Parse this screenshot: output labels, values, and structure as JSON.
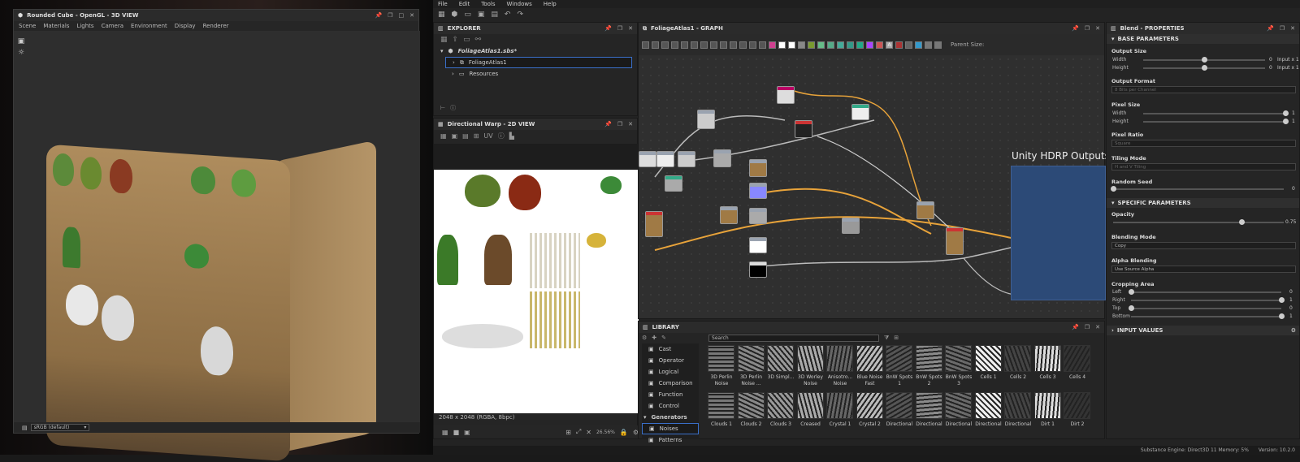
{
  "view3d": {
    "title": "Rounded Cube - OpenGL - 3D VIEW",
    "menu": [
      "Scene",
      "Materials",
      "Lights",
      "Camera",
      "Environment",
      "Display",
      "Renderer"
    ],
    "colorspace": "sRGB (default)"
  },
  "app_menu": [
    "File",
    "Edit",
    "Tools",
    "Windows",
    "Help"
  ],
  "explorer": {
    "title": "EXPLORER",
    "package": "FoliageAtlas1.sbs*",
    "graph_item": "FoliageAtlas1",
    "resources": "Resources"
  },
  "view2d": {
    "title": "Directional Warp - 2D VIEW",
    "uv_label": "UV",
    "info": "2048 x 2048 (RGBA, 8bpc)",
    "zoom": "26.56%"
  },
  "graph": {
    "title": "FoliageAtlas1 - GRAPH",
    "parent_size_label": "Parent Size:",
    "frame_label": "Unity HDRP Outputs"
  },
  "library": {
    "title": "LIBRARY",
    "search_placeholder": "Search",
    "categories": [
      "Cast",
      "Operator",
      "Logical",
      "Comparison",
      "Function",
      "Control"
    ],
    "group": "Generators",
    "subcategories": [
      "Noises",
      "Patterns"
    ],
    "row1": [
      "3D Perlin Noise",
      "3D Perlin Noise ...",
      "3D Simpl...",
      "3D Worley Noise",
      "Anisotro... Noise",
      "Blue Noise Fast",
      "BnW Spots 1",
      "BnW Spots 2",
      "BnW Spots 3",
      "Cells 1",
      "Cells 2",
      "Cells 3",
      "Cells 4"
    ],
    "row2": [
      "Clouds 1",
      "Clouds 2",
      "Clouds 3",
      "Creased",
      "Crystal 1",
      "Crystal 2",
      "Directional",
      "Directional",
      "Directional",
      "Directional",
      "Directional",
      "Dirt 1",
      "Dirt 2"
    ]
  },
  "properties": {
    "title": "Blend - PROPERTIES",
    "base_section": "BASE PARAMETERS",
    "output_size": {
      "label": "Output Size",
      "width_label": "Width",
      "height_label": "Height",
      "width_value": "0",
      "height_value": "0",
      "width_suffix": "Input x 1",
      "height_suffix": "Input x 1",
      "width_level": 0.5,
      "height_level": 0.5
    },
    "output_format": {
      "label": "Output Format",
      "value": "8 Bits per Channel"
    },
    "pixel_size": {
      "label": "Pixel Size",
      "width_label": "Width",
      "height_label": "Height",
      "width_value": "1",
      "height_value": "1",
      "width_level": 1,
      "height_level": 1
    },
    "pixel_ratio": {
      "label": "Pixel Ratio",
      "value": "Square"
    },
    "tiling_mode": {
      "label": "Tiling Mode",
      "value": "H and V Tiling"
    },
    "random_seed": {
      "label": "Random Seed",
      "value": "0",
      "level": 0
    },
    "specific_section": "SPECIFIC PARAMETERS",
    "opacity": {
      "label": "Opacity",
      "value": "0.75",
      "level": 0.75
    },
    "blending_mode": {
      "label": "Blending Mode",
      "value": "Copy"
    },
    "alpha_blending": {
      "label": "Alpha Blending",
      "value": "Use Source Alpha"
    },
    "cropping": {
      "label": "Cropping Area",
      "items": [
        {
          "label": "Left",
          "value": "0",
          "level": 0
        },
        {
          "label": "Right",
          "value": "1",
          "level": 1
        },
        {
          "label": "Top",
          "value": "0",
          "level": 0
        },
        {
          "label": "Bottom",
          "value": "1",
          "level": 1
        }
      ]
    },
    "input_section": "INPUT VALUES"
  },
  "status": {
    "engine": "Substance Engine: Direct3D 11  Memory: 5%",
    "version": "Version: 10.2.0"
  },
  "colors": {
    "accent": "#3a6fc9",
    "frame": "#2c4a77",
    "link_orange": "#e8a33a"
  }
}
